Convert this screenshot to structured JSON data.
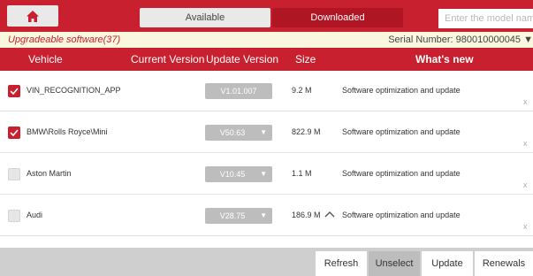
{
  "tabs": {
    "available": "Available",
    "downloaded": "Downloaded"
  },
  "search": {
    "placeholder": "Enter the model name"
  },
  "info": {
    "upgradeable": "Upgradeable software(37)",
    "serial": "Serial Number: 980010000045 ▼"
  },
  "columns": {
    "vehicle": "Vehicle",
    "current_version": "Current Version",
    "update_version": "Update Version",
    "size": "Size",
    "whats_new": "What's new"
  },
  "rows": [
    {
      "checked": true,
      "name": "VIN_RECOGNITION_APP",
      "version": "V1.01.007",
      "dropdown": false,
      "size": "9.2 M",
      "news": "Software optimization and update",
      "expand_icon": ""
    },
    {
      "checked": true,
      "name": "BMW\\Rolls Royce\\Mini",
      "version": "V50.63",
      "dropdown": true,
      "size": "822.9 M",
      "news": "Software optimization and update",
      "expand_icon": ""
    },
    {
      "checked": false,
      "name": "Aston Martin",
      "version": "V10.45",
      "dropdown": true,
      "size": "1.1 M",
      "news": "Software optimization and update",
      "expand_icon": ""
    },
    {
      "checked": false,
      "name": "Audi",
      "version": "V28.75",
      "dropdown": true,
      "size": "186.9 M",
      "news": "Software optimization and update",
      "expand_icon": "chevron-up-icon"
    }
  ],
  "row_close": "x",
  "buttons": {
    "refresh": "Refresh",
    "unselect": "Unselect",
    "update": "Update",
    "renewals": "Renewals"
  },
  "colors": {
    "accent": "#c8202f",
    "info_bg": "#fbf7de",
    "version_badge": "#bdbdbd"
  }
}
